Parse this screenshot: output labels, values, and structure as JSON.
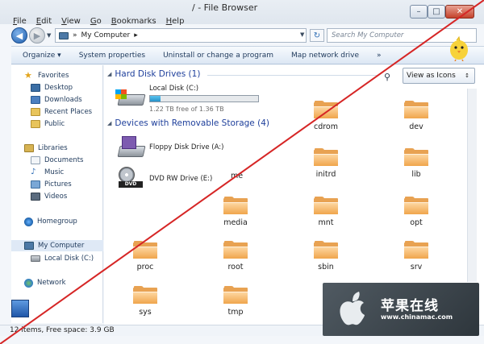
{
  "window": {
    "title": "/ - File Browser",
    "menu": [
      "File",
      "Edit",
      "View",
      "Go",
      "Bookmarks",
      "Help"
    ],
    "controls": {
      "min": "–",
      "max": "□",
      "close": "✕"
    }
  },
  "address": {
    "back_glyph": "◀",
    "fwd_glyph": "▶",
    "path_root": "»",
    "path": "My Computer",
    "path_sep": "▸",
    "dropdown": "▼",
    "refresh_glyph": "↻",
    "search_placeholder": "Search My Computer"
  },
  "toolbar": {
    "items": [
      "Organize ▾",
      "System properties",
      "Uninstall or change a program",
      "Map network drive",
      "»"
    ]
  },
  "sidebar": {
    "favorites": {
      "label": "Favorites",
      "items": [
        "Desktop",
        "Downloads",
        "Recent Places",
        "Public"
      ]
    },
    "libraries": {
      "label": "Libraries",
      "items": [
        "Documents",
        "Music",
        "Pictures",
        "Videos"
      ]
    },
    "homegroup": "Homegroup",
    "computer": {
      "label": "My Computer",
      "items": [
        "Local Disk (C:)"
      ]
    },
    "network": "Network"
  },
  "content": {
    "view_as": "View as Icons",
    "view_arrow": "↕",
    "zoom_icon_glyph": "⚲",
    "hard_disks_header": "Hard Disk Drives (1)",
    "removable_header": "Devices with Removable Storage (4)",
    "group_toggle": "◢",
    "local_disk": {
      "name": "Local Disk (C:)",
      "free": "1.22 TB free of 1.36 TB",
      "used_fraction": 0.1
    },
    "removable": [
      {
        "name": "Floppy Disk Drive (A:)"
      },
      {
        "name": "DVD RW Drive (E:)",
        "badge": "DVD"
      }
    ],
    "folders": [
      "cdrom",
      "dev",
      "initrd",
      "lib",
      "media",
      "mnt",
      "opt",
      "proc",
      "root",
      "sbin",
      "srv",
      "sys",
      "tmp"
    ],
    "partial_label": "me"
  },
  "status": {
    "text": "12 items, Free space: 3.9 GB"
  },
  "watermark": {
    "cn": "苹果在线",
    "url": "www.chinamac.com"
  },
  "colors": {
    "strike": "#d62626",
    "link_blue": "#1e3f9b",
    "folder": "#f0a54c"
  }
}
